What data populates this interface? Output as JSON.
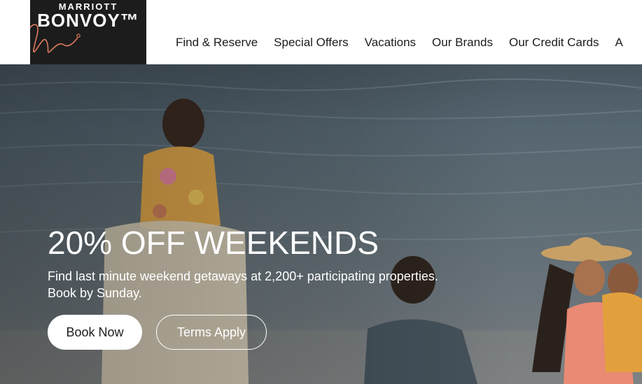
{
  "logo": {
    "top_text": "MARRIOTT",
    "main_text": "BONVOY™",
    "brand_color": "#1c1c1c",
    "accent_color": "#e07b5f"
  },
  "nav": {
    "items": [
      {
        "label": "Find & Reserve"
      },
      {
        "label": "Special Offers"
      },
      {
        "label": "Vacations"
      },
      {
        "label": "Our Brands"
      },
      {
        "label": "Our Credit Cards"
      },
      {
        "label": "A"
      }
    ]
  },
  "hero": {
    "title": "20% OFF WEEKENDS",
    "subtitle_line1": "Find last minute weekend getaways at 2,200+ participating properties.",
    "subtitle_line2": "Book by Sunday.",
    "primary_button": "Book Now",
    "secondary_button": "Terms Apply"
  }
}
